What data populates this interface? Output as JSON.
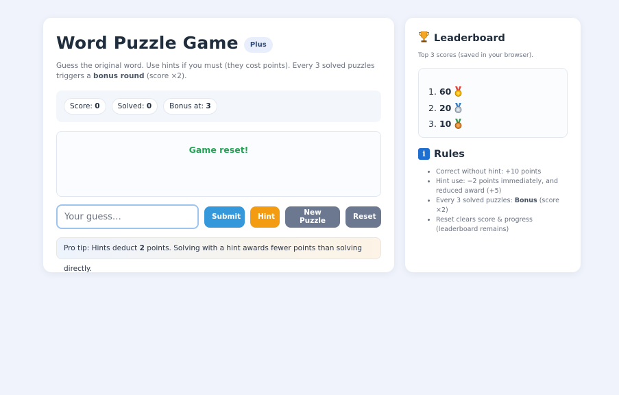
{
  "game": {
    "title": "Word Puzzle Game",
    "badge": "Plus",
    "description_prefix": "Guess the original word. Use hints if you must (they cost points). Every 3 solved puzzles triggers a",
    "description_bold": "bonus round",
    "description_suffix": "(score ×2)."
  },
  "stats": {
    "score_label": "Score:",
    "score_value": "0",
    "solved_label": "Solved:",
    "solved_value": "0",
    "bonus_label": "Bonus at:",
    "bonus_value": "3"
  },
  "message": {
    "text": "Game reset!",
    "color": "#23a455"
  },
  "controls": {
    "guess_placeholder": "Your guess…",
    "guess_value": "",
    "submit_label": "Submit",
    "hint_label": "Hint",
    "new_puzzle_label": "New Puzzle",
    "reset_label": "Reset"
  },
  "tip": {
    "prefix": "Pro tip: Hints deduct",
    "bold": "2",
    "suffix": "points. Solving with a hint awards fewer points than solving directly."
  },
  "leaderboard": {
    "icon": "trophy-icon",
    "title": "Leaderboard",
    "subtitle": "Top 3 scores (saved in your browser).",
    "entries": [
      {
        "rank": "1.",
        "score": "60",
        "medal": "gold-medal-icon"
      },
      {
        "rank": "2.",
        "score": "20",
        "medal": "silver-medal-icon"
      },
      {
        "rank": "3.",
        "score": "10",
        "medal": "bronze-medal-icon"
      }
    ]
  },
  "rules": {
    "icon": "info-icon",
    "icon_glyph": "i",
    "title": "Rules",
    "items": [
      {
        "text": "Correct without hint: +10 points"
      },
      {
        "text": "Hint use: −2 points immediately, and reduced award (+5)"
      },
      {
        "prefix": "Every 3 solved puzzles:",
        "bold": "Bonus",
        "suffix": "(score ×2)"
      },
      {
        "text": "Reset clears score & progress (leaderboard remains)"
      }
    ]
  },
  "colors": {
    "background": "#f0f3fb",
    "primary": "#3498db",
    "hint": "#f39c12",
    "secondary": "#6b7890",
    "success": "#23a455"
  }
}
